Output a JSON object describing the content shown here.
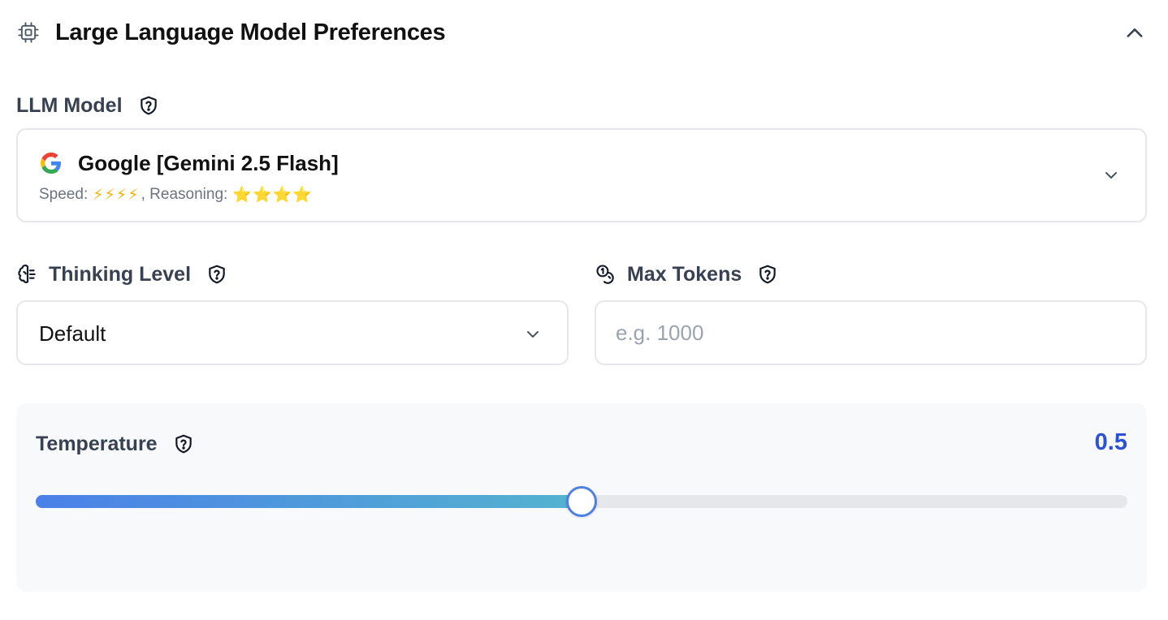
{
  "header": {
    "title": "Large Language Model Preferences",
    "cpu_icon": "cpu-chip-icon",
    "collapse_icon": "chevron-up-icon"
  },
  "llm_model": {
    "label": "LLM Model",
    "help_icon": "shield-question-icon",
    "provider_icon": "google-logo-icon",
    "selected": "Google [Gemini 2.5 Flash]",
    "speed_label": "Speed:",
    "speed_value": "⚡⚡⚡⚡",
    "reasoning_label": ", Reasoning:",
    "reasoning_value": "⭐⭐⭐⭐",
    "speed_rating": 4,
    "reasoning_rating": 4
  },
  "thinking_level": {
    "label": "Thinking Level",
    "icon": "brain-icon",
    "help_icon": "shield-question-icon",
    "selected": "Default"
  },
  "max_tokens": {
    "label": "Max Tokens",
    "icon": "coins-icon",
    "help_icon": "shield-question-icon",
    "value": "",
    "placeholder": "e.g. 1000"
  },
  "temperature": {
    "label": "Temperature",
    "help_icon": "shield-question-icon",
    "value_text": "0.5",
    "value": 0.5,
    "min": 0,
    "max": 1
  },
  "colors": {
    "accent": "#2b52d3",
    "slider_start": "#4a80e8",
    "slider_end": "#54b3cf",
    "border": "#e5e7eb",
    "card_bg": "#f8f9fb"
  }
}
